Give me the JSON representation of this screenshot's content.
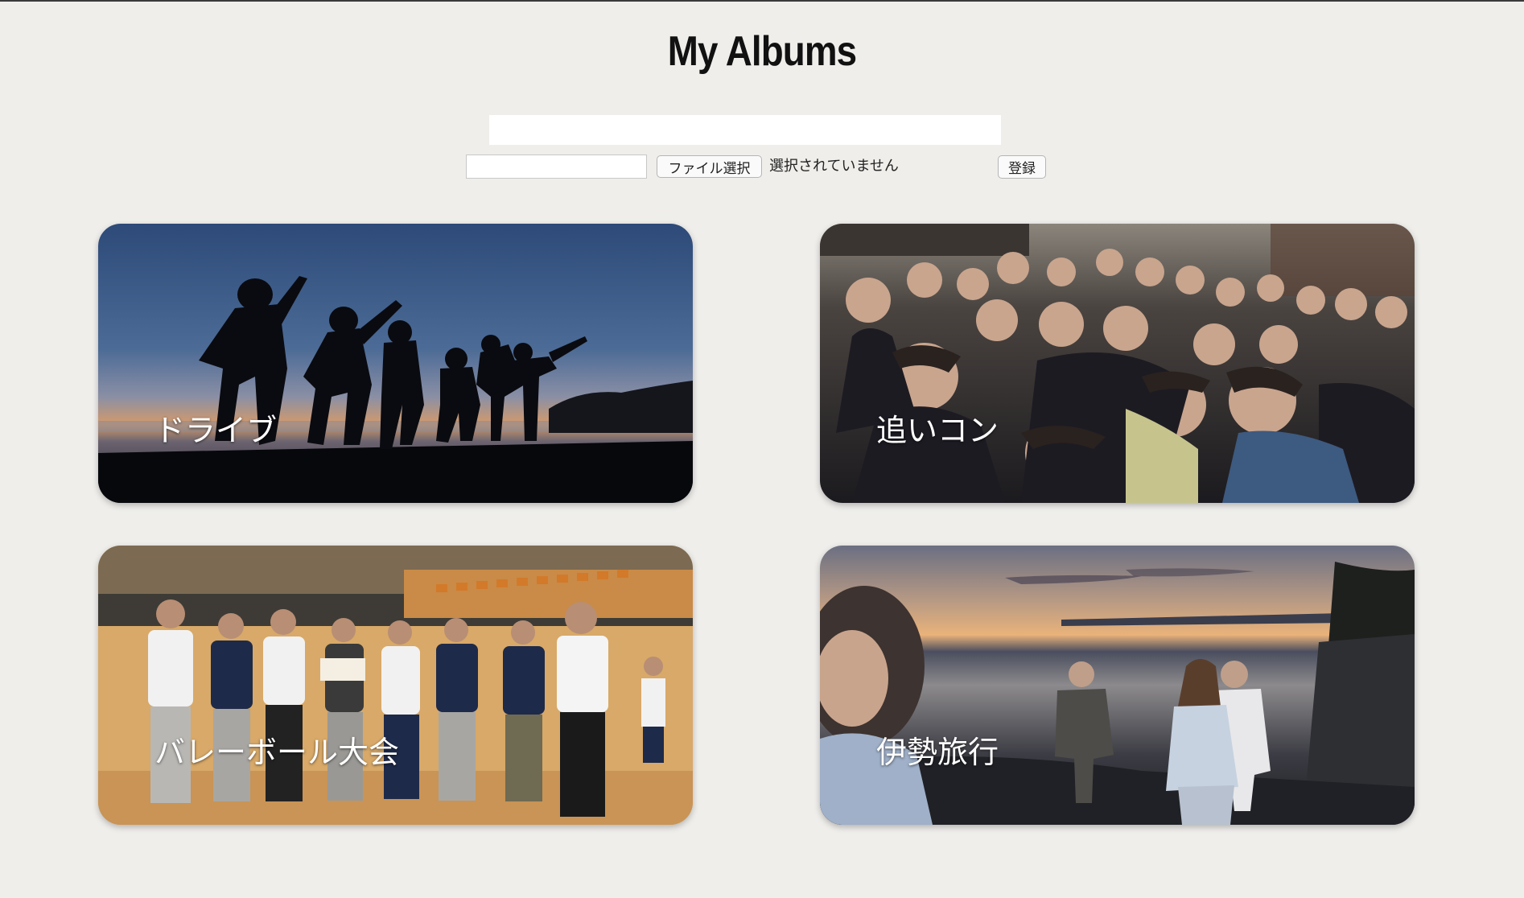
{
  "page": {
    "title": "My Albums"
  },
  "form": {
    "album_name_value": "",
    "small_input_value": "",
    "file_button_label": "ファイル選択",
    "file_status": "選択されていません",
    "register_label": "登録"
  },
  "albums": [
    {
      "label": "ドライブ",
      "photo": "sunset-silhouettes-photo"
    },
    {
      "label": "追いコン",
      "photo": "party-group-selfie-photo"
    },
    {
      "label": "バレーボール大会",
      "photo": "gym-team-photo"
    },
    {
      "label": "伊勢旅行",
      "photo": "seaside-sunset-photo"
    }
  ],
  "colors": {
    "background": "#efeeeb",
    "label_text": "#ffffff"
  }
}
